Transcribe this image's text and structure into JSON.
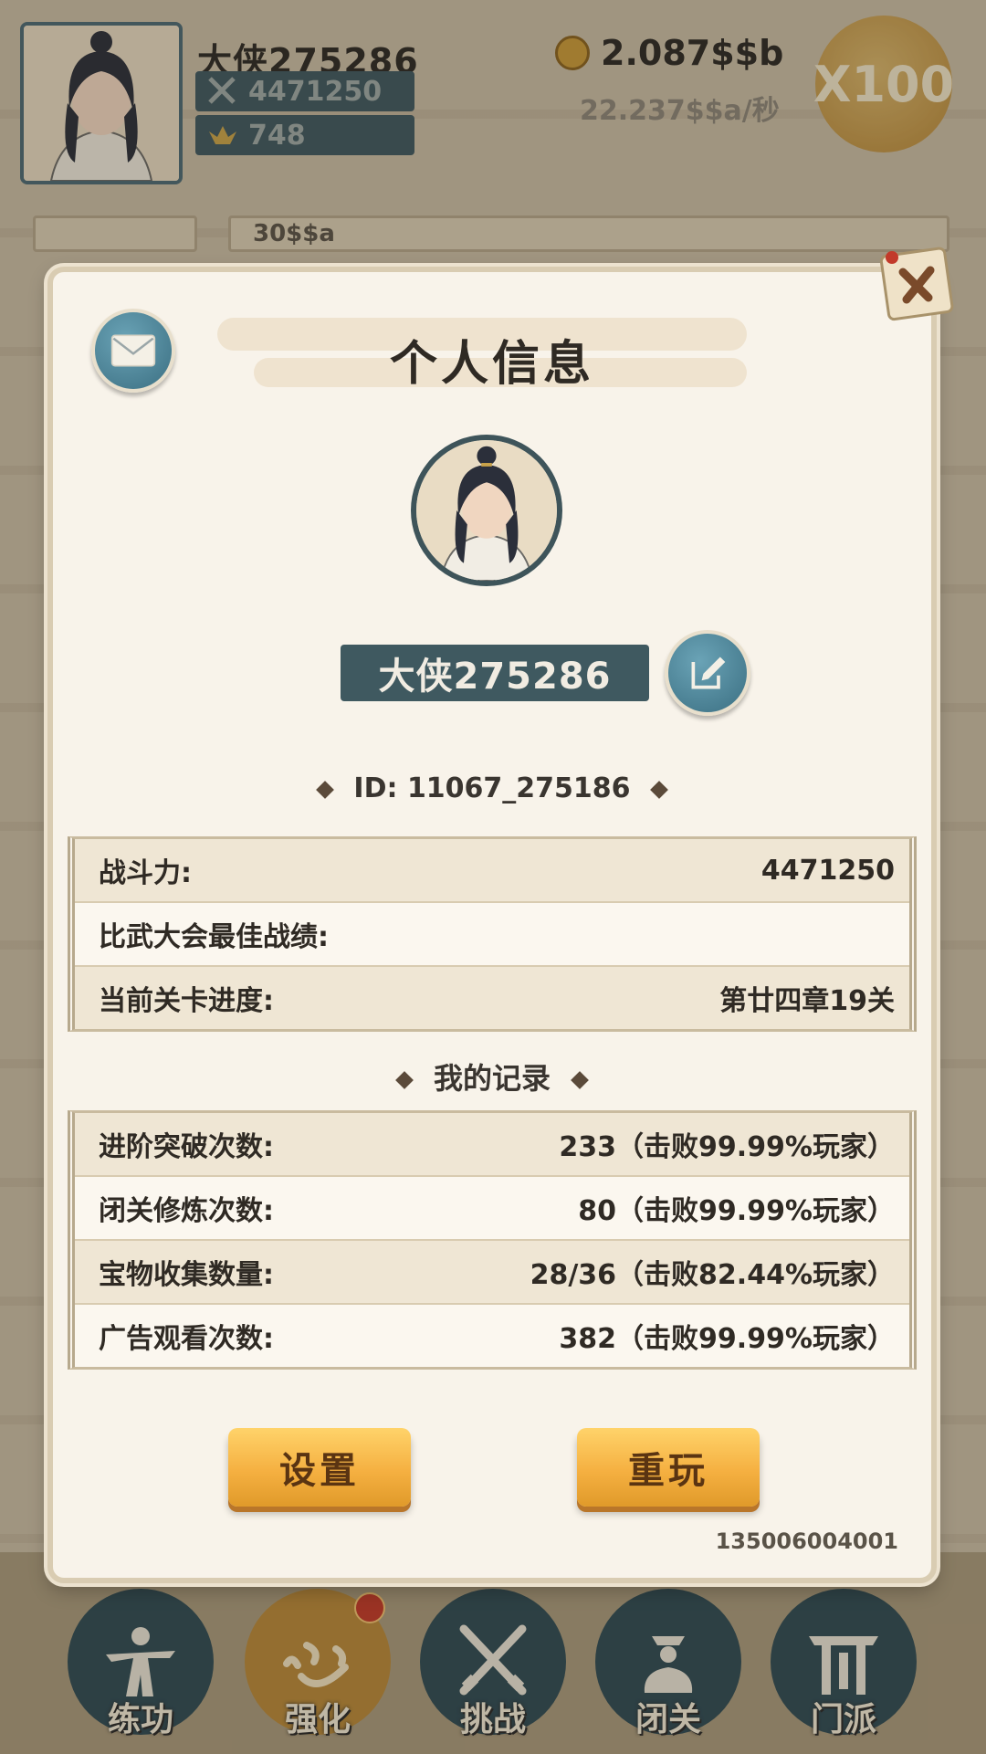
{
  "topbar": {
    "player_name": "大侠275286",
    "power": "4471250",
    "ingots": "748",
    "gold": "2.087$$b",
    "gold_rate": "22.237$$a/秒",
    "multiplier": "X100"
  },
  "background": {
    "partial_text": "30$$a"
  },
  "modal": {
    "title": "个人信息",
    "name": "大侠275286",
    "id_label": "ID:",
    "id_value": "11067_275186",
    "stats": [
      {
        "label": "战斗力:",
        "value": "4471250"
      },
      {
        "label": "比武大会最佳战绩:",
        "value": ""
      },
      {
        "label": "当前关卡进度:",
        "value": "第廿四章19关"
      }
    ],
    "records_title": "我的记录",
    "records": [
      {
        "label": "进阶突破次数:",
        "value": "233（击败99.99%玩家）"
      },
      {
        "label": "闭关修炼次数:",
        "value": "80（击败99.99%玩家）"
      },
      {
        "label": "宝物收集数量:",
        "value": "28/36（击败82.44%玩家）"
      },
      {
        "label": "广告观看次数:",
        "value": "382（击败99.99%玩家）"
      }
    ],
    "settings_button": "设置",
    "replay_button": "重玩",
    "build_number": "135006004001"
  },
  "nav": [
    {
      "label": "练功",
      "icon": "martial-figure-icon"
    },
    {
      "label": "强化",
      "icon": "heart-calligraphy-icon"
    },
    {
      "label": "挑战",
      "icon": "crossed-swords-icon"
    },
    {
      "label": "闭关",
      "icon": "meditation-icon"
    },
    {
      "label": "门派",
      "icon": "gate-icon"
    }
  ]
}
